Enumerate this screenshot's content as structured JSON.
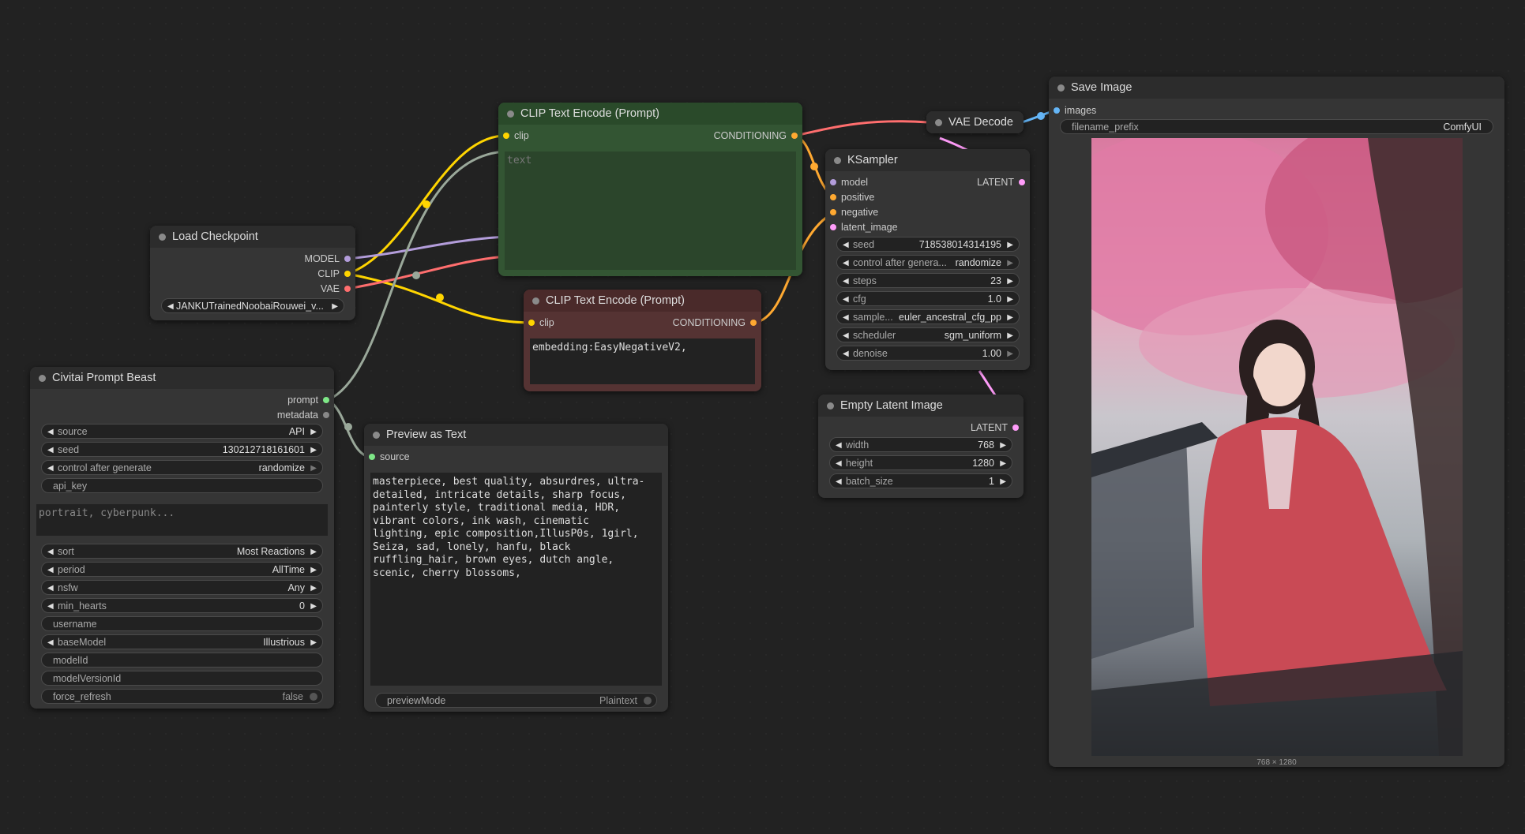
{
  "nodes": {
    "clip_pos": {
      "title": "CLIP Text Encode (Prompt)",
      "input_clip": "clip",
      "output": "CONDITIONING",
      "placeholder": "text"
    },
    "clip_neg": {
      "title": "CLIP Text Encode (Prompt)",
      "input_clip": "clip",
      "output": "CONDITIONING",
      "text": "embedding:EasyNegativeV2,"
    },
    "load_ckpt": {
      "title": "Load Checkpoint",
      "outputs": [
        "MODEL",
        "CLIP",
        "VAE"
      ],
      "ckpt_name": "JANKUTrainedNoobaiRouwei_v..."
    },
    "vae_decode": {
      "title": "VAE Decode"
    },
    "ksampler": {
      "title": "KSampler",
      "inputs": [
        "model",
        "positive",
        "negative",
        "latent_image"
      ],
      "output": "LATENT",
      "widgets": [
        {
          "label": "seed",
          "value": "718538014314195"
        },
        {
          "label": "control after genera...",
          "value": "randomize"
        },
        {
          "label": "steps",
          "value": "23"
        },
        {
          "label": "cfg",
          "value": "1.0"
        },
        {
          "label": "sample...",
          "value": "euler_ancestral_cfg_pp"
        },
        {
          "label": "scheduler",
          "value": "sgm_uniform"
        },
        {
          "label": "denoise",
          "value": "1.00"
        }
      ]
    },
    "empty_latent": {
      "title": "Empty Latent Image",
      "output": "LATENT",
      "widgets": [
        {
          "label": "width",
          "value": "768"
        },
        {
          "label": "height",
          "value": "1280"
        },
        {
          "label": "batch_size",
          "value": "1"
        }
      ]
    },
    "save_image": {
      "title": "Save Image",
      "input": "images",
      "prefix_label": "filename_prefix",
      "prefix_value": "ComfyUI",
      "size_caption": "768 × 1280"
    },
    "civitai": {
      "title": "Civitai Prompt Beast",
      "outputs": [
        "prompt",
        "metadata"
      ],
      "widgets_top": [
        {
          "label": "source",
          "value": "API"
        },
        {
          "label": "seed",
          "value": "130212718161601"
        },
        {
          "label": "control after generate",
          "value": "randomize"
        }
      ],
      "api_key": "api_key",
      "query_placeholder": "portrait, cyberpunk...",
      "widgets_bottom": [
        {
          "label": "sort",
          "value": "Most Reactions"
        },
        {
          "label": "period",
          "value": "AllTime"
        },
        {
          "label": "nsfw",
          "value": "Any"
        },
        {
          "label": "min_hearts",
          "value": "0"
        }
      ],
      "username": "username",
      "base_model": {
        "label": "baseModel",
        "value": "Illustrious"
      },
      "model_id": "modelId",
      "model_version_id": "modelVersionId",
      "force_refresh": {
        "label": "force_refresh",
        "value": "false"
      }
    },
    "preview": {
      "title": "Preview as Text",
      "input": "source",
      "text": "masterpiece, best quality, absurdres, ultra-\ndetailed, intricate details, sharp focus,\npainterly style, traditional media, HDR,\nvibrant colors, ink wash, cinematic\nlighting, epic composition,IllusP0s, 1girl,\nSeiza, sad, lonely, hanfu, black\nruffling_hair, brown eyes, dutch angle,\nscenic, cherry blossoms,",
      "mode_label": "previewMode",
      "mode_value": "Plaintext"
    }
  },
  "colors": {
    "clip": "#ffd500",
    "model": "#b39ddb",
    "vae": "#ff6e6e",
    "conditioning": "#ffa931",
    "latent": "#ff9cf9",
    "image": "#64b5f6",
    "string": "#9aa89a"
  }
}
